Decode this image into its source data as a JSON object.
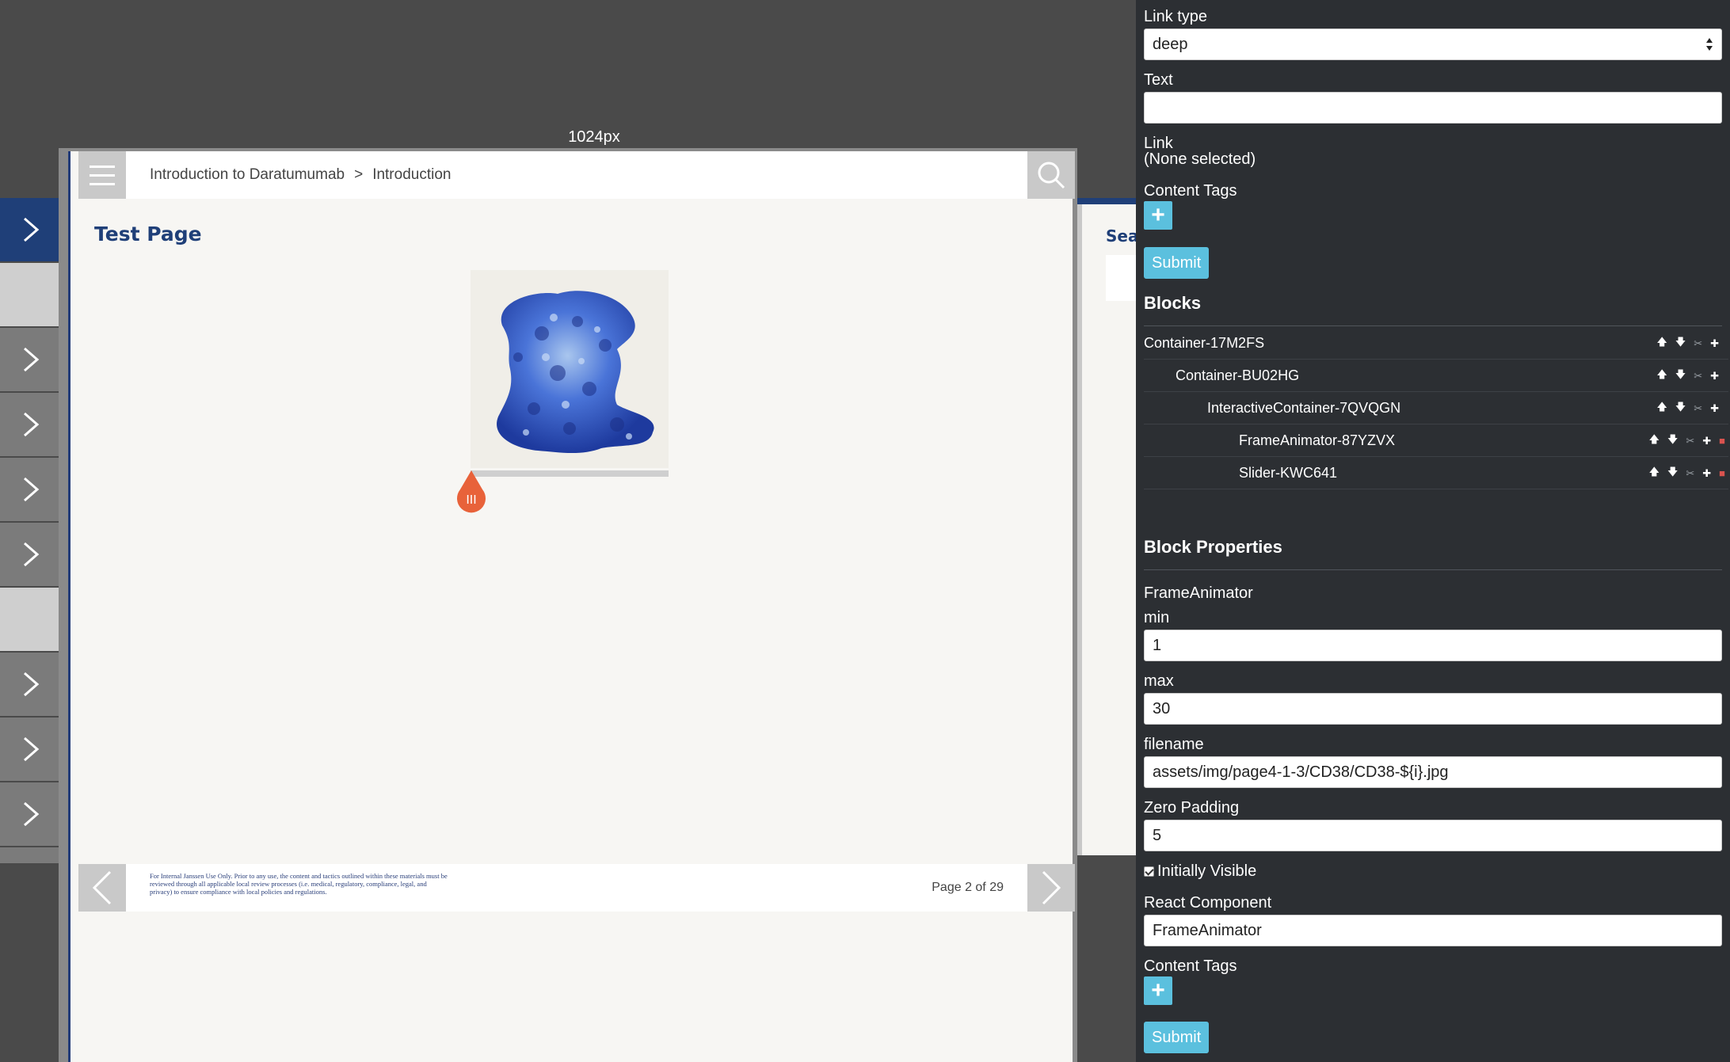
{
  "canvas": {
    "width_label": "1024px",
    "breadcrumb": {
      "course": "Introduction to Daratumumab",
      "separator": ">",
      "section": "Introduction"
    },
    "page_title": "Test Page",
    "search_peek": "Sear",
    "footer": {
      "disclaimer": "For Internal Janssen Use Only. Prior to any use, the content and tactics outlined within these materials must be reviewed through all applicable local review processes (i.e. medical, regulatory, compliance, legal, and privacy) to ensure compliance with local policies and regulations.",
      "page_indicator": "Page 2 of 29"
    },
    "slider_handle_glyph": "III",
    "slider_value_fraction": 0,
    "accent_color": "#1f3f78",
    "handle_color": "#e8623a"
  },
  "editor": {
    "link_type": {
      "label": "Link type",
      "value": "deep"
    },
    "text": {
      "label": "Text",
      "value": ""
    },
    "link": {
      "label": "Link",
      "value": "(None selected)"
    },
    "content_tags_label": "Content Tags",
    "submit_label": "Submit",
    "blocks_title": "Blocks",
    "blocks": [
      {
        "name": "Container-17M2FS"
      },
      {
        "name": "Container-BU02HG"
      },
      {
        "name": "InteractiveContainer-7QVQGN"
      },
      {
        "name": "FrameAnimator-87YZVX"
      },
      {
        "name": "Slider-KWC641"
      }
    ],
    "block_properties_title": "Block Properties",
    "component_type": "FrameAnimator",
    "min": {
      "label": "min",
      "value": "1"
    },
    "max": {
      "label": "max",
      "value": "30"
    },
    "filename": {
      "label": "filename",
      "value": "assets/img/page4-1-3/CD38/CD38-${i}.jpg"
    },
    "zero_padding": {
      "label": "Zero Padding",
      "value": "5"
    },
    "initially_visible": {
      "label": "Initially Visible",
      "checked": true
    },
    "react_component": {
      "label": "React Component",
      "value": "FrameAnimator"
    },
    "content_tags_label_2": "Content Tags",
    "submit_label_2": "Submit",
    "accent_color": "#5bc0de"
  }
}
